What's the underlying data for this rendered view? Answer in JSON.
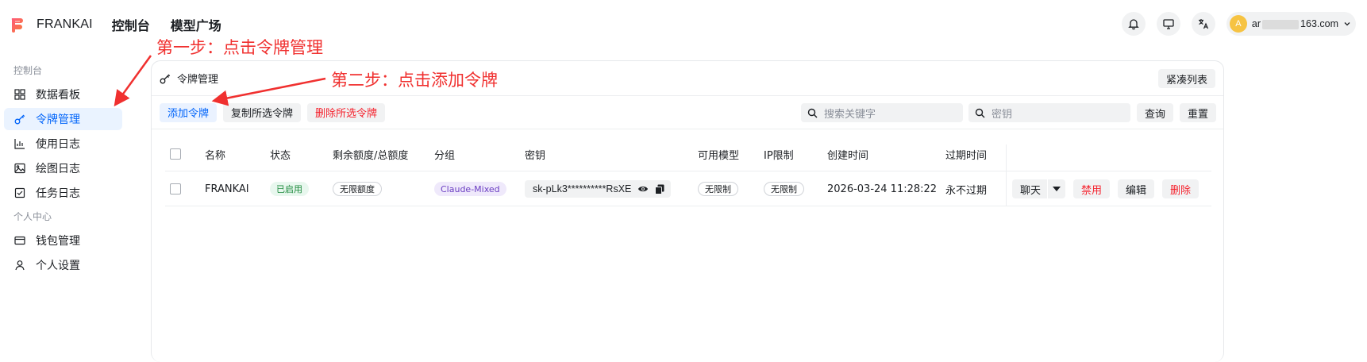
{
  "header": {
    "brand": "FRANKAI",
    "nav": [
      "控制台",
      "模型广场"
    ],
    "user": {
      "avatar": "A",
      "email_prefix": "ar",
      "email_suffix": "163.com"
    }
  },
  "sidebar": {
    "section_console": "控制台",
    "section_personal": "个人中心",
    "items": [
      {
        "label": "数据看板",
        "icon": "dashboard-icon"
      },
      {
        "label": "令牌管理",
        "icon": "key-icon",
        "active": true
      },
      {
        "label": "使用日志",
        "icon": "chart-icon"
      },
      {
        "label": "绘图日志",
        "icon": "image-icon"
      },
      {
        "label": "任务日志",
        "icon": "task-icon"
      }
    ],
    "personal_items": [
      {
        "label": "钱包管理",
        "icon": "wallet-icon"
      },
      {
        "label": "个人设置",
        "icon": "user-icon"
      }
    ]
  },
  "panel": {
    "title": "令牌管理",
    "compact_button": "紧凑列表",
    "toolbar": {
      "add": "添加令牌",
      "copy_selected": "复制所选令牌",
      "delete_selected": "删除所选令牌",
      "search_placeholder": "搜索关键字",
      "key_placeholder": "密钥",
      "query": "查询",
      "reset": "重置"
    }
  },
  "table": {
    "columns": [
      "名称",
      "状态",
      "剩余额度/总额度",
      "分组",
      "密钥",
      "可用模型",
      "IP限制",
      "创建时间",
      "过期时间"
    ],
    "rows": [
      {
        "name": "FRANKAI",
        "status": "已启用",
        "quota": "无限额度",
        "group": "Claude-Mixed",
        "key": "sk-pLk3**********RsXE",
        "models": "无限制",
        "ip": "无限制",
        "created": "2026-03-24 11:28:22",
        "expires": "永不过期",
        "actions": {
          "chat": "聊天",
          "disable": "禁用",
          "edit": "编辑",
          "delete": "删除"
        }
      }
    ]
  },
  "annotations": {
    "step1": "第一步：点击令牌管理",
    "step2": "第二步：点击添加令牌"
  },
  "colors": {
    "accent": "#0064fa",
    "danger": "#f5222d",
    "annotation": "#f0302f"
  }
}
